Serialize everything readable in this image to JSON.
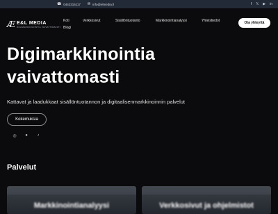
{
  "topbar": {
    "phone": "0442315117",
    "email": "info@elmedia.fi",
    "phone_icon": "phone-icon",
    "email_icon": "mail-icon",
    "social_icons": [
      "facebook-icon",
      "twitter-icon",
      "youtube-icon",
      "linkedin-icon"
    ]
  },
  "logo": {
    "name": "E&L MEDIA",
    "tagline": "DIGIMARKKINOINTIA VAIVATTOMASTI"
  },
  "nav": {
    "items": [
      "Koti",
      "Verkkosivut",
      "Sisällöntuotanto",
      "Markkinointianalyysi",
      "Yhteistiedot",
      "Blogi"
    ],
    "cta": "Ota yhteyttä"
  },
  "hero": {
    "title_line1": "Digimarkkinointia",
    "title_line2": "vaivattomasti",
    "subtitle": "Kattavat ja laadukkaat sisällöntuotannon ja digitaalisenmarkkinoinnin palvelut",
    "button": "Kokemuksia",
    "social_icons": [
      "instagram-icon",
      "facebook-icon",
      "tiktok-icon"
    ]
  },
  "services": {
    "title": "Palvelut",
    "cards": [
      "Markkinointianalyysi",
      "Verkkosivut ja ohjelmistot"
    ]
  },
  "colors": {
    "background": "#0b0b0d",
    "topbar": "#232a37",
    "cta": "#ffffff"
  }
}
